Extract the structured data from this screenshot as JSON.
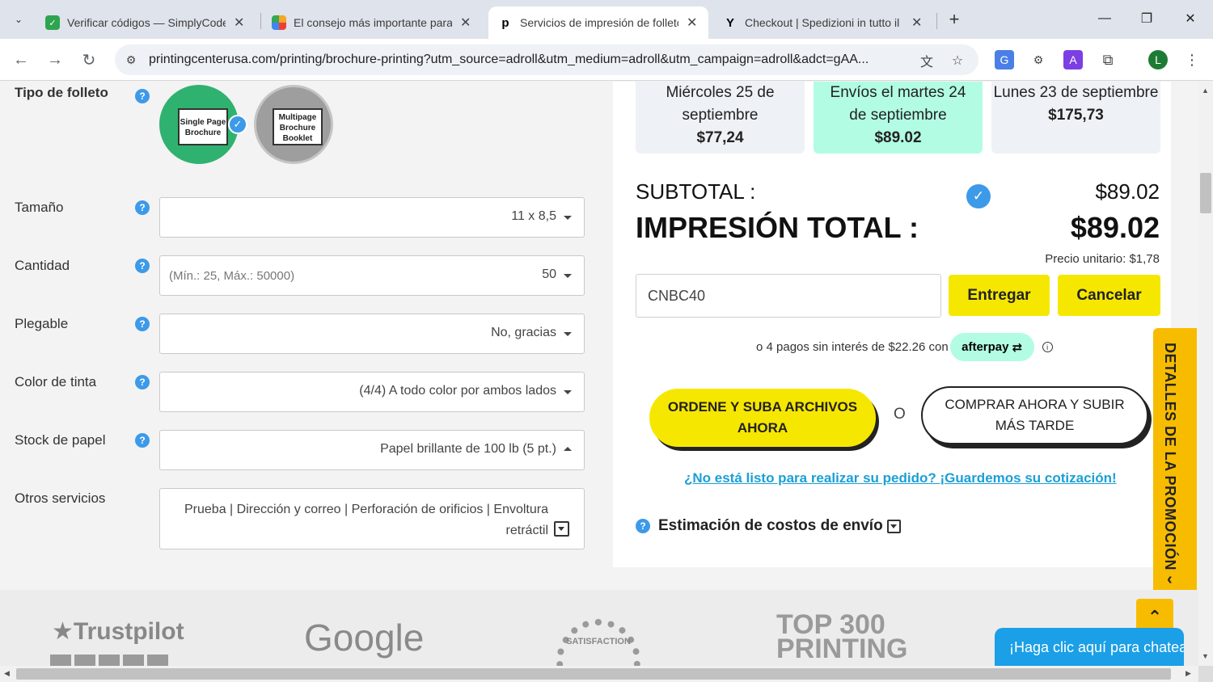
{
  "browser": {
    "tabs": [
      {
        "title": "Verificar códigos — SimplyCode",
        "active": false
      },
      {
        "title": "El consejo más importante para",
        "active": false
      },
      {
        "title": "Servicios de impresión de folleto",
        "active": true
      },
      {
        "title": "Checkout | Spedizioni in tutto il",
        "active": false
      }
    ],
    "url": "printingcenterusa.com/printing/brochure-printing?utm_source=adroll&utm_medium=adroll&utm_campaign=adroll&adct=gAA...",
    "profile_initial": "L"
  },
  "form": {
    "brochure_type_label": "Tipo de folleto",
    "brochure_options": [
      {
        "label": "Single Page Brochure",
        "selected": true
      },
      {
        "label": "Multipage Brochure Booklet",
        "selected": false
      }
    ],
    "size": {
      "label": "Tamaño",
      "value": "11 x 8,5"
    },
    "quantity": {
      "label": "Cantidad",
      "placeholder": "(Mín.: 25, Máx.: 50000)",
      "value": "50"
    },
    "folding": {
      "label": "Plegable",
      "value": "No, gracias"
    },
    "ink_color": {
      "label": "Color de tinta",
      "value": "(4/4) A todo color por ambos lados"
    },
    "paper_stock": {
      "label": "Stock de papel",
      "value": "Papel brillante de 100 lb (5 pt.)"
    },
    "other_services": {
      "label": "Otros servicios",
      "value": "Prueba | Dirección y correo | Perforación de orificios | Envoltura retráctil"
    }
  },
  "shipping": [
    {
      "date": "Miércoles 25 de septiembre",
      "price": "$77,24",
      "selected": false
    },
    {
      "date": "Envíos el martes 24 de septiembre",
      "price": "$89.02",
      "selected": true
    },
    {
      "date": "Lunes 23 de septiembre",
      "price": "$175,73",
      "selected": false
    }
  ],
  "summary": {
    "subtotal_label": "SUBTOTAL :",
    "subtotal_value": "$89.02",
    "total_label": "IMPRESIÓN TOTAL :",
    "total_value": "$89.02",
    "unit_price": "Precio unitario:  $1,78"
  },
  "coupon": {
    "value": "CNBC40",
    "submit_label": "Entregar",
    "cancel_label": "Cancelar"
  },
  "afterpay": {
    "text": "o 4 pagos sin interés de $22.26 con",
    "brand": "afterpay"
  },
  "actions": {
    "order_upload": "ORDENE Y SUBA ARCHIVOS AHORA",
    "or_text": "O",
    "buy_later": "COMPRAR AHORA Y SUBIR MÁS TARDE",
    "save_quote": "¿No está listo para realizar su pedido? ¡Guardemos su cotización!",
    "shipping_estimate": "Estimación de costos de envío"
  },
  "promo_tab": "DETALLES DE LA PROMOCIÓN",
  "trust_logos": [
    "Trustpilot",
    "Google",
    "SATISFACTION",
    "TOP 300 PRINTING"
  ],
  "chat": "¡Haga clic aquí para chatear!",
  "colors": {
    "accent_yellow": "#f6e700",
    "selected_green": "#b2fce4",
    "link_blue": "#1b9fd6",
    "promo_orange": "#f7bc00"
  }
}
